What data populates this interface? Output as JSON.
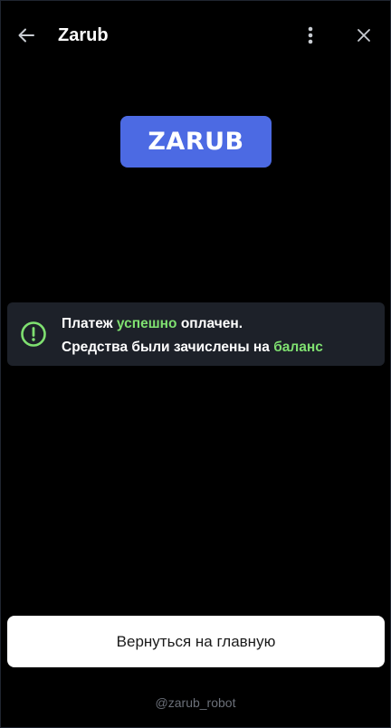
{
  "header": {
    "title": "Zarub",
    "back_icon": "arrow-left-icon",
    "menu_icon": "vertical-dots-icon",
    "close_icon": "close-icon"
  },
  "logo": {
    "text": "ZARUB",
    "background_color": "#4c6ae3"
  },
  "alert": {
    "icon": "exclamation-circle-icon",
    "accent_color": "#7fe070",
    "line1": {
      "part1": "Платеж ",
      "highlight": "успешно",
      "part2": " оплачен."
    },
    "line2": {
      "part1": "Средства были зачислены на ",
      "highlight": "баланс"
    }
  },
  "home_button": {
    "label": "Вернуться на главную"
  },
  "footer": {
    "bot_name": "@zarub_robot"
  }
}
